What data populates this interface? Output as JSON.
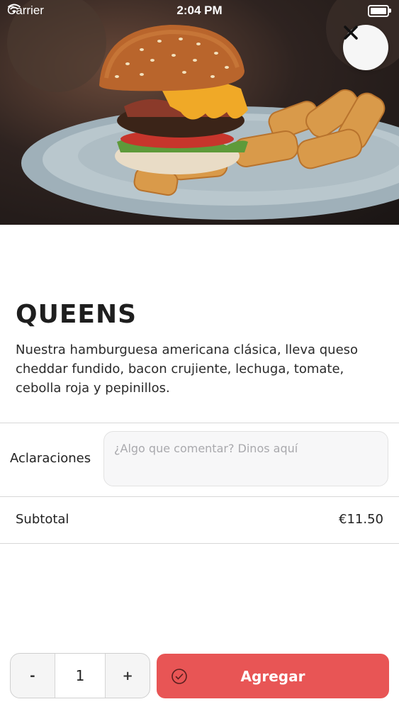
{
  "status_bar": {
    "carrier": "Carrier",
    "time": "2:04 PM"
  },
  "product": {
    "name": "QUEENS",
    "description": "Nuestra hamburguesa americana clásica, lleva queso cheddar fundido, bacon crujiente, lechuga, tomate, cebolla roja y pepinillos."
  },
  "notes": {
    "label": "Aclaraciones",
    "placeholder": "¿Algo que comentar? Dinos aquí",
    "value": ""
  },
  "subtotal": {
    "label": "Subtotal",
    "value": "€11.50"
  },
  "stepper": {
    "minus": "-",
    "quantity": "1",
    "plus": "+"
  },
  "add_button": {
    "label": "Agregar"
  },
  "icons": {
    "close": "close-icon",
    "wifi": "wifi-icon",
    "battery": "battery-icon",
    "check": "check-circle-icon"
  },
  "colors": {
    "accent": "#e85555"
  }
}
